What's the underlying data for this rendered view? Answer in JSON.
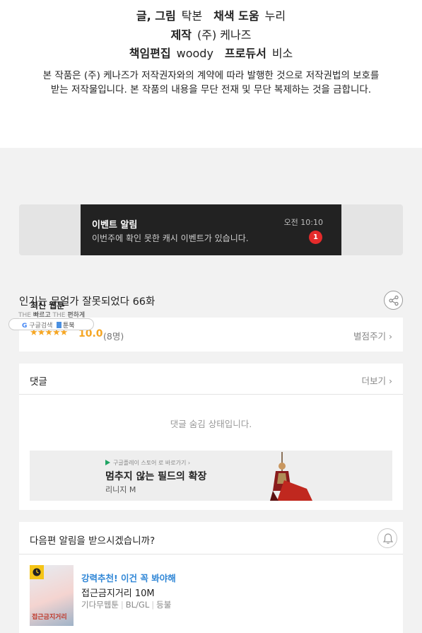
{
  "credits": {
    "art_label": "글, 그림",
    "art_value": "탁본",
    "color_label": "채색 도움",
    "color_value": "누리",
    "production_label": "제작",
    "production_value": "(주) 케나즈",
    "editor_label": "책임편집",
    "editor_value": "woody",
    "producer_label": "프로듀서",
    "producer_value": "비소",
    "notice_line1": "본 작품은 (주) 케나즈가 저작권자와의 계약에 따라 발행한 것으로 저작권법의 보호를",
    "notice_line2": "받는 저작물입니다. 본 작품의 내용을 무단 전재 및 무단 복제하는 것을 금합니다."
  },
  "event": {
    "title": "이벤트 알림",
    "desc": "이번주에 확인 못한 캐시 이벤트가 있습니다.",
    "time": "오전 10:10",
    "badge": "1"
  },
  "episode": {
    "title": "인기는 무얼가 잘못되었다 66화"
  },
  "float_widget": {
    "title": "최신 웹툰",
    "sub_the1": "THE",
    "sub_fast": "빠르고",
    "sub_the2": "THE",
    "sub_easy": "편하게",
    "google_g": "G",
    "google_label": "구글검색",
    "book_label": "툰북"
  },
  "rating": {
    "stars": "★★★★★",
    "score": "10.0",
    "count": "(8명)",
    "rate_link": "별점주기 ›"
  },
  "comments": {
    "title": "댓글",
    "more": "더보기 ›",
    "hidden_msg": "댓글 숨김 상태입니다."
  },
  "ad": {
    "store": "구글플레이 스토어 로 바로가기 ›",
    "headline": "멈추지 않는 필드의 확장",
    "brand": "리니지 M"
  },
  "notify": {
    "title": "다음편 알림을 받으시겠습니까?"
  },
  "recommend": {
    "thumb_title": "접근금지거리",
    "tag": "강력추천! 이건 꼭 봐야해",
    "name": "접근금지거리 10M",
    "meta_author": "기다무웹툰",
    "meta_genre": "BL/GL",
    "meta_status": "등불"
  },
  "colors": {
    "accent_star": "#f5a623",
    "accent_blue": "#2f86d6",
    "badge_red": "#e52b2b",
    "event_bg": "#222222"
  }
}
